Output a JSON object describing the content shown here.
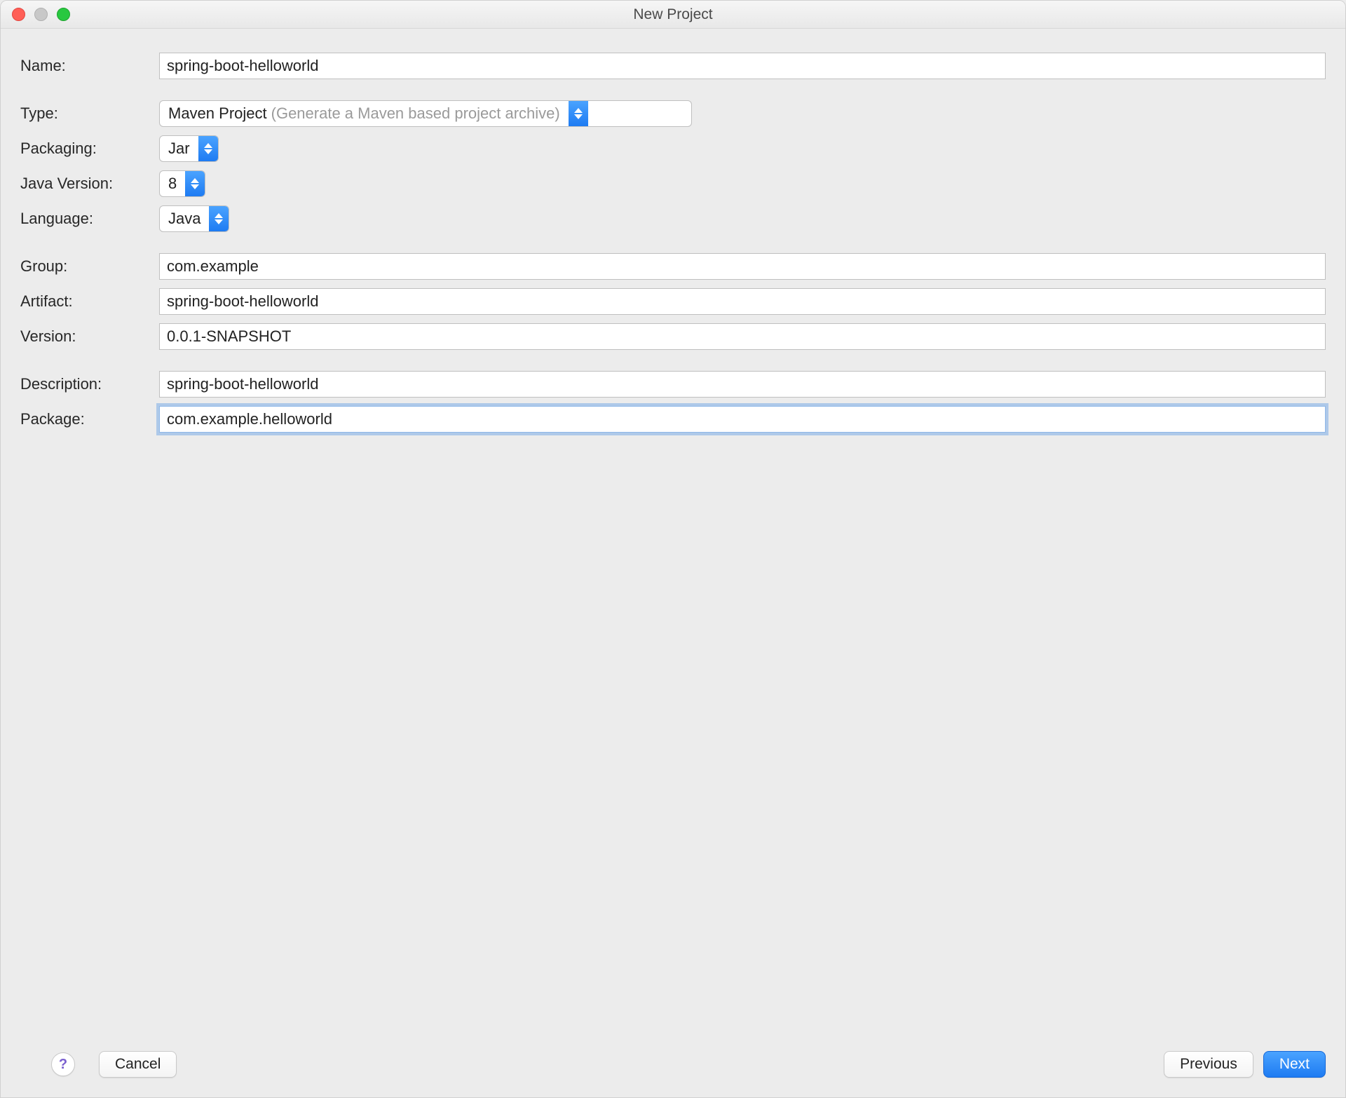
{
  "window": {
    "title": "New Project"
  },
  "labels": {
    "name": "Name:",
    "type": "Type:",
    "packaging": "Packaging:",
    "javaVersion": "Java Version:",
    "language": "Language:",
    "group": "Group:",
    "artifact": "Artifact:",
    "version": "Version:",
    "description": "Description:",
    "package": "Package:"
  },
  "fields": {
    "name": "spring-boot-helloworld",
    "type": {
      "value": "Maven Project",
      "hint": "(Generate a Maven based project archive)"
    },
    "packaging": "Jar",
    "javaVersion": "8",
    "language": "Java",
    "group": "com.example",
    "artifact": "spring-boot-helloworld",
    "version": "0.0.1-SNAPSHOT",
    "description": "spring-boot-helloworld",
    "package": "com.example.helloworld"
  },
  "footer": {
    "help": "?",
    "cancel": "Cancel",
    "previous": "Previous",
    "next": "Next"
  }
}
